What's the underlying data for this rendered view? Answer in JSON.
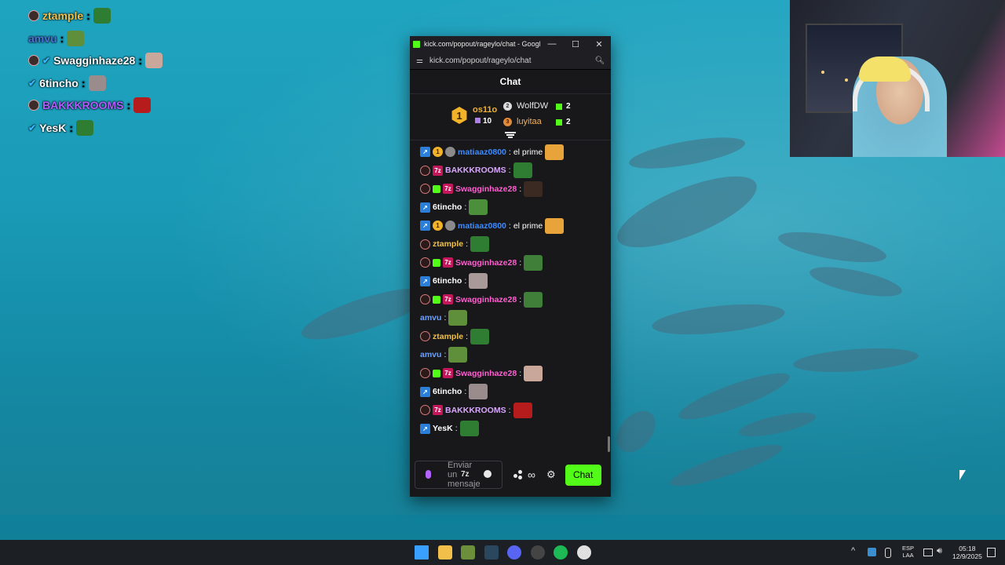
{
  "overlay_chat": [
    {
      "user": "ztample",
      "color": "#f0c24a",
      "sep": ":",
      "badge": true,
      "verified": false,
      "emote_color": "#2e7d32"
    },
    {
      "user": "amvu",
      "color": "#4a73d8",
      "sep": ":",
      "badge": false,
      "verified": false,
      "emote_color": "#5f8f3a"
    },
    {
      "user": "Swagginhaze28",
      "color": "#ffffff",
      "sep": ":",
      "badge": true,
      "verified": true,
      "emote_color": "#c9a79a"
    },
    {
      "user": "6tincho",
      "color": "#ffffff",
      "sep": ":",
      "badge": false,
      "verified": true,
      "emote_color": "#9a8c8c"
    },
    {
      "user": "BAKKKROOMS",
      "color": "#b35cff",
      "sep": ":",
      "badge": true,
      "verified": false,
      "emote_color": "#b71c1c"
    },
    {
      "user": "YesK",
      "color": "#ffffff",
      "sep": ":",
      "badge": false,
      "verified": true,
      "emote_color": "#2e7d32"
    }
  ],
  "browser": {
    "title": "kick.com/popout/rageylo/chat - Google...",
    "url": "kick.com/popout/rageylo/chat",
    "minimize": "—",
    "maximize": "☐",
    "close": "✕"
  },
  "chat": {
    "header": "Chat",
    "leaderboard": {
      "first": {
        "rank": "1",
        "name": "os11o",
        "count": "10"
      },
      "second": {
        "rank": "2",
        "name": "WolfDW",
        "count": "2"
      },
      "third": {
        "rank": "3",
        "name": "luyitaa",
        "count": "2"
      }
    },
    "messages": [
      {
        "badges": [
          "ver",
          "one",
          "coin"
        ],
        "user": "matiaaz0800",
        "color": "#3d8bff",
        "text": " el prime",
        "emote": "#e8a33a"
      },
      {
        "badges": [
          "og",
          "sub"
        ],
        "user": "BAKKKROOMS",
        "color": "#d9a7ff",
        "text": "",
        "emote": "#2e7d32"
      },
      {
        "badges": [
          "og",
          "gift",
          "sub"
        ],
        "user": "Swagginhaze28",
        "color": "#ff5fd0",
        "text": "",
        "emote": "#3b2a22"
      },
      {
        "badges": [
          "ver"
        ],
        "user": "6tincho",
        "color": "#ffffff",
        "text": "",
        "emote": "#4c8f3a"
      },
      {
        "badges": [
          "ver",
          "one",
          "coin"
        ],
        "user": "matiaaz0800",
        "color": "#3d8bff",
        "text": " el prime",
        "emote": "#e8a33a"
      },
      {
        "badges": [
          "og"
        ],
        "user": "ztample",
        "color": "#f0c24a",
        "text": "",
        "emote": "#2e7d32"
      },
      {
        "badges": [
          "og",
          "gift",
          "sub"
        ],
        "user": "Swagginhaze28",
        "color": "#ff5fd0",
        "text": "",
        "emote": "#3f7f3a"
      },
      {
        "badges": [
          "ver"
        ],
        "user": "6tincho",
        "color": "#ffffff",
        "text": "",
        "emote": "#a99"
      },
      {
        "badges": [
          "og",
          "gift",
          "sub"
        ],
        "user": "Swagginhaze28",
        "color": "#ff5fd0",
        "text": "",
        "emote": "#3f7f3a"
      },
      {
        "badges": [],
        "user": "amvu",
        "color": "#6aa0ff",
        "text": "",
        "emote": "#5f8f3a"
      },
      {
        "badges": [
          "og"
        ],
        "user": "ztample",
        "color": "#f0c24a",
        "text": "",
        "emote": "#2e7d32"
      },
      {
        "badges": [],
        "user": "amvu",
        "color": "#6aa0ff",
        "text": "",
        "emote": "#5f8f3a"
      },
      {
        "badges": [
          "og",
          "gift",
          "sub"
        ],
        "user": "Swagginhaze28",
        "color": "#ff5fd0",
        "text": "",
        "emote": "#c9a79a"
      },
      {
        "badges": [
          "ver"
        ],
        "user": "6tincho",
        "color": "#ffffff",
        "text": "",
        "emote": "#9a8c8c"
      },
      {
        "badges": [
          "og",
          "sub"
        ],
        "user": "BAKKKROOMS",
        "color": "#d9a7ff",
        "text": "",
        "emote": "#b71c1c"
      },
      {
        "badges": [
          "ver"
        ],
        "user": "YesK",
        "color": "#ffffff",
        "text": "",
        "emote": "#2e7d32"
      }
    ],
    "input": {
      "placeholder": "Enviar un mensaje",
      "kick_emote": "7z"
    },
    "infinity": "∞",
    "gear": "⚙",
    "send_label": "Chat"
  },
  "taskbar": {
    "apps": [
      {
        "name": "windows-start",
        "color": "#3aa0ff"
      },
      {
        "name": "file-explorer",
        "color": "#f2c04a"
      },
      {
        "name": "app-pepe",
        "color": "#6b8f3a"
      },
      {
        "name": "steam",
        "color": "#2a475e"
      },
      {
        "name": "discord",
        "color": "#5865f2"
      },
      {
        "name": "obs",
        "color": "#444"
      },
      {
        "name": "spotify",
        "color": "#1db954"
      },
      {
        "name": "chrome",
        "color": "#e0e0e0"
      }
    ],
    "tray": {
      "chevron": "^",
      "lang_top": "ESP",
      "lang_bottom": "LAA",
      "time": "05:18",
      "date": "12/9/2025"
    }
  },
  "colors": {
    "kick_green": "#53fc18",
    "popup_bg": "#18181b"
  }
}
